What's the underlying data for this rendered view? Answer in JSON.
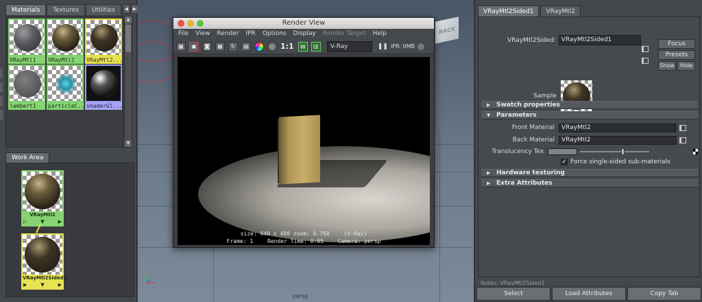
{
  "left": {
    "tabs": [
      "Materials",
      "Textures",
      "Utilities"
    ],
    "materials": [
      "VRayMtl1",
      "VRayMtl2",
      "VRayMtl2...",
      "lambert1",
      "particleC...",
      "shaderGl..."
    ],
    "work_area_tab": "Work Area",
    "nodes": [
      "VRayMtl2",
      "VRayMtl2Sided1"
    ]
  },
  "viewport": {
    "cube_label": "BACK",
    "camera_label": "persp"
  },
  "render_view": {
    "title": "Render View",
    "menu": [
      "File",
      "View",
      "Render",
      "IPR",
      "Options",
      "Display",
      "Render Target",
      "Help"
    ],
    "ratio": "1:1",
    "renderer": "V-Ray",
    "ipr_status": "IPR: 0MB",
    "info_size": "size: 640 x 480 zoom: 0.760",
    "info_renderer": "(V-Ray)",
    "info_frame": "Frame: 1",
    "info_time": "Render Time: 0:05",
    "info_camera": "Camera: persp"
  },
  "attr": {
    "tabs": [
      "VRayMtl2Sided1",
      "VRayMtl2"
    ],
    "name_label": "VRayMtl2Sided:",
    "name_value": "VRayMtl2Sided1",
    "focus": "Focus",
    "presets": "Presets",
    "show": "Show",
    "hide": "Hide",
    "sample_label": "Sample",
    "sections": {
      "swatch": "Swatch properties",
      "parameters": "Parameters",
      "hardware": "Hardware texturing",
      "extra": "Extra Attributes"
    },
    "front_label": "Front Material",
    "front_value": "VRayMtl2",
    "back_label": "Back Material",
    "back_value": "VRayMtl2",
    "translucency_label": "Translucency Tex",
    "force_label": "Force single-sided sub-materials",
    "notes": "Notes: VRayMtl2Sided1",
    "bottom": [
      "Select",
      "Load Attributes",
      "Copy Tab"
    ]
  }
}
